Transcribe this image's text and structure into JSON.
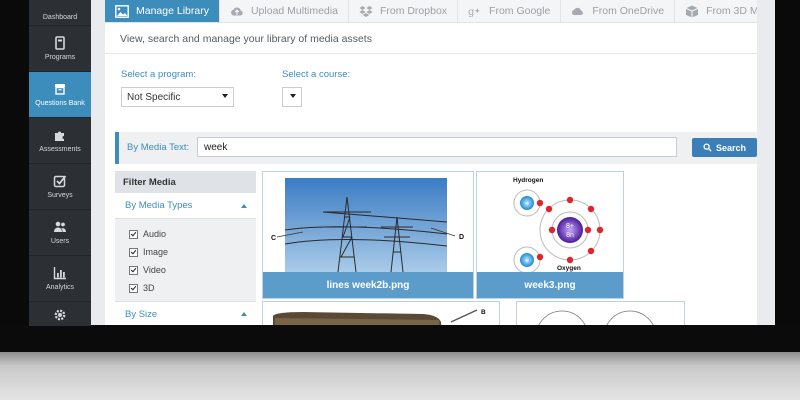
{
  "sidebar": {
    "items": [
      {
        "label": "Dashboard",
        "icon": "dashboard-icon"
      },
      {
        "label": "Programs",
        "icon": "book-icon"
      },
      {
        "label": "Questions Bank",
        "icon": "archive-icon"
      },
      {
        "label": "Assessments",
        "icon": "puzzle-icon"
      },
      {
        "label": "Surveys",
        "icon": "checkbox-icon"
      },
      {
        "label": "Users",
        "icon": "users-icon"
      },
      {
        "label": "Analytics",
        "icon": "bar-chart-icon"
      }
    ]
  },
  "tabs": [
    {
      "label": "Manage Library",
      "icon": "image-icon"
    },
    {
      "label": "Upload Multimedia",
      "icon": "cloud-upload-icon"
    },
    {
      "label": "From Dropbox",
      "icon": "dropbox-icon"
    },
    {
      "label": "From Google",
      "icon": "google-plus-icon"
    },
    {
      "label": "From OneDrive",
      "icon": "cloud-icon"
    },
    {
      "label": "From 3D Models",
      "icon": "cube-icon"
    }
  ],
  "subtitle": "View, search and manage your library of media assets",
  "program": {
    "label": "Select a program:",
    "value": "Not Specific"
  },
  "course": {
    "label": "Select a course:",
    "value": ""
  },
  "search": {
    "label": "By Media Text:",
    "value": "week",
    "button": "Search"
  },
  "filter": {
    "title": "Filter Media",
    "media_types": {
      "label": "By Media Types",
      "options": [
        "Audio",
        "Image",
        "Video",
        "3D"
      ]
    },
    "size": {
      "label": "By Size"
    }
  },
  "media": [
    {
      "caption": "lines week2b.png",
      "labels": [
        "C",
        "D"
      ]
    },
    {
      "caption": "week3.png",
      "labels": [
        "Hydrogen",
        "Oxygen",
        "8+",
        "8n"
      ]
    },
    {
      "caption": "",
      "labels": [
        "B"
      ]
    },
    {
      "caption": "",
      "labels": []
    }
  ],
  "colors": {
    "accent": "#3c8dbc",
    "sidebar": "#2c2f33",
    "caption": "#5b9ccb"
  }
}
